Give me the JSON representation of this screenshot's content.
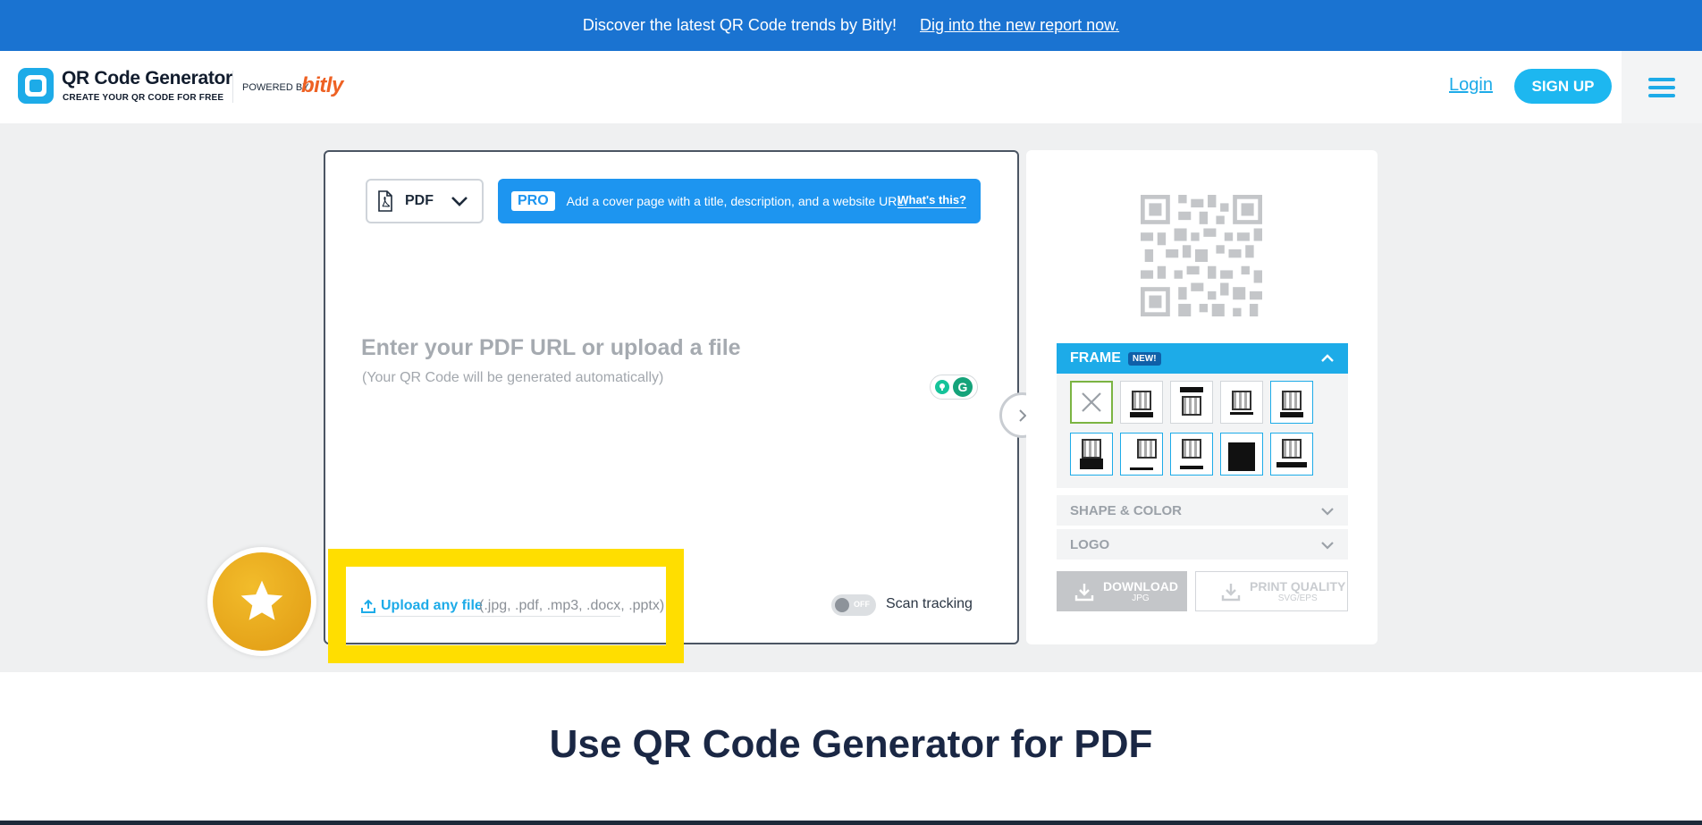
{
  "banner": {
    "message": "Discover the latest QR Code trends by Bitly!",
    "link": "Dig into the new report now."
  },
  "header": {
    "title": "QR Code Generator",
    "subtitle": "CREATE YOUR QR CODE FOR FREE",
    "powered_by": "POWERED BY",
    "brand": "bitly",
    "login": "Login",
    "signup": "SIGN UP"
  },
  "editor": {
    "type_label": "PDF",
    "pro_badge": "PRO",
    "pro_text": "Add a cover page with a title, description, and a website URL.",
    "pro_link": "What's this?",
    "input_placeholder": "Enter your PDF URL or upload a file",
    "input_hint": "(Your QR Code will be generated automatically)",
    "upload_link": "Upload any file",
    "upload_ext": "(.jpg, .pdf, .mp3, .docx, .pptx)",
    "toggle_state": "OFF",
    "scan_tracking": "Scan tracking"
  },
  "panel": {
    "frame_label": "FRAME",
    "new_badge": "NEW!",
    "shape_color": "SHAPE & COLOR",
    "logo": "LOGO",
    "download_label": "DOWNLOAD",
    "download_sub": "JPG",
    "print_label": "PRINT QUALITY",
    "print_sub": "SVG/EPS"
  },
  "bottom": {
    "heading": "Use QR Code Generator for PDF"
  },
  "colors": {
    "banner": "#1a73d1",
    "accent": "#1dabe8",
    "highlight": "#ffde00",
    "brand_orange": "#ee6123"
  }
}
